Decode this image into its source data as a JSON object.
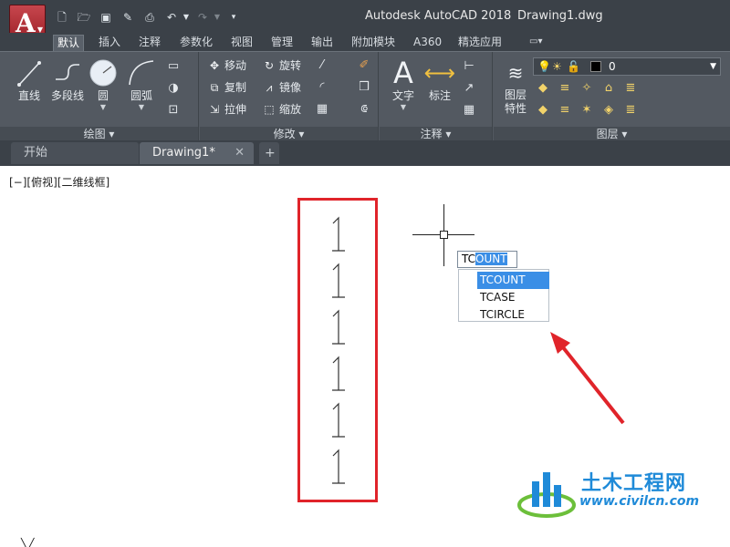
{
  "titlebar": {
    "app_title": "Autodesk AutoCAD 2018",
    "doc_title": "Drawing1.dwg"
  },
  "ribbon_tabs": [
    "默认",
    "插入",
    "注释",
    "参数化",
    "视图",
    "管理",
    "输出",
    "附加模块",
    "A360",
    "精选应用"
  ],
  "panels": {
    "draw": {
      "title": "绘图 ▾",
      "line": "直线",
      "polyline": "多段线",
      "circle": "圆",
      "arc": "圆弧"
    },
    "modify": {
      "title": "修改 ▾",
      "move": "移动",
      "rotate": "旋转",
      "copy": "复制",
      "mirror": "镜像",
      "stretch": "拉伸",
      "scale": "缩放"
    },
    "annotation": {
      "title": "注释 ▾",
      "text": "文字",
      "dimension": "标注"
    },
    "layers": {
      "title": "图层 ▾",
      "layer_props_line1": "图层",
      "layer_props_line2": "特性",
      "current_layer": "0"
    }
  },
  "doc_tabs": {
    "start": "开始",
    "drawing": "Drawing1*"
  },
  "canvas": {
    "viewport_label": "[−][俯视][二维线框]",
    "glyph": "1",
    "command_typed": "TC",
    "command_autocomplete": "OUNT",
    "suggestions": [
      "TCOUNT",
      "TCASE",
      "TCIRCLE"
    ],
    "active_suggestion": 0,
    "number_count": 6
  },
  "watermark": {
    "name": "土木工程网",
    "url": "www.civilcn.com"
  },
  "colors": {
    "highlight": "#e0242a",
    "selection": "#3a8ee6",
    "ribbon_bg": "#535961"
  }
}
